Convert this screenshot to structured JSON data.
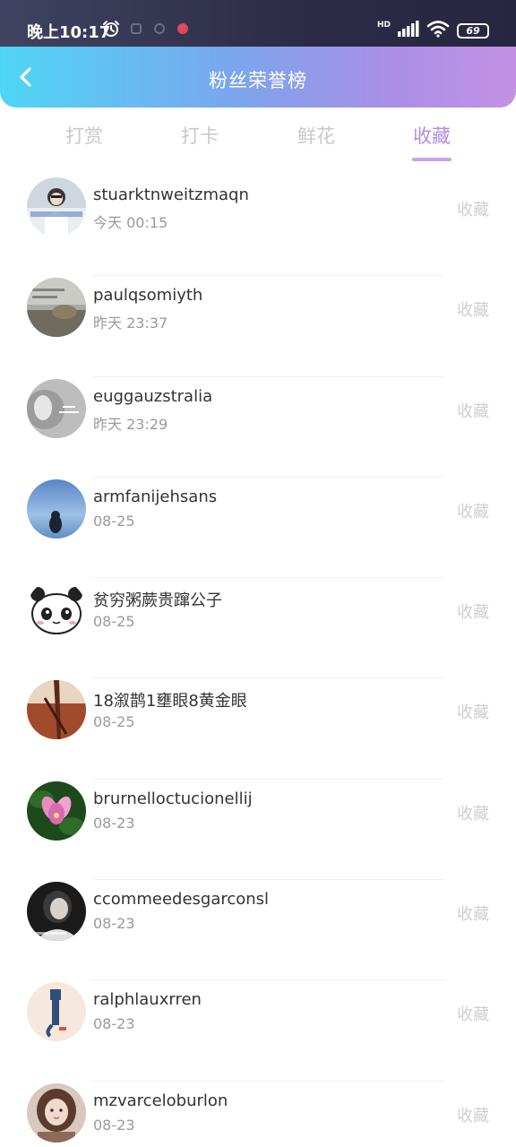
{
  "status_bar": {
    "time": "晚上10:17",
    "battery": "69",
    "network_label": "HD"
  },
  "header": {
    "title": "粉丝荣誉榜"
  },
  "tabs": [
    {
      "label": "打赏",
      "active": false
    },
    {
      "label": "打卡",
      "active": false
    },
    {
      "label": "鲜花",
      "active": false
    },
    {
      "label": "收藏",
      "active": true
    }
  ],
  "list": [
    {
      "name": "stuarktnweitzmaqn",
      "time": "今天 00:15",
      "action": "收藏"
    },
    {
      "name": "paulqsomiyth",
      "time": "昨天 23:37",
      "action": "收藏"
    },
    {
      "name": "euggauzstralia",
      "time": "昨天 23:29",
      "action": "收藏"
    },
    {
      "name": "armfanijehsans",
      "time": "08-25",
      "action": "收藏"
    },
    {
      "name": "贫穷粥蕨贵蹿公子",
      "time": "08-25",
      "action": "收藏"
    },
    {
      "name": "18溆鹊1壅眼8黄金眼",
      "time": "08-25",
      "action": "收藏"
    },
    {
      "name": "brurnelloctucionellij",
      "time": "08-23",
      "action": "收藏"
    },
    {
      "name": "ccommeedesgarconsl",
      "time": "08-23",
      "action": "收藏"
    },
    {
      "name": "ralphlauxrren",
      "time": "08-23",
      "action": "收藏"
    },
    {
      "name": "mzvarceloburlon",
      "time": "08-23",
      "action": "收藏"
    }
  ],
  "colors": {
    "accent": "#b58be0",
    "header_gradient_start": "#4fd6f6",
    "header_gradient_end": "#c391e3",
    "status_bar": "#2c2b45"
  },
  "icons": {
    "back": "chevron-left-icon",
    "alarm": "alarm-clock-icon",
    "signal": "signal-icon",
    "wifi": "wifi-icon",
    "battery": "battery-icon"
  }
}
